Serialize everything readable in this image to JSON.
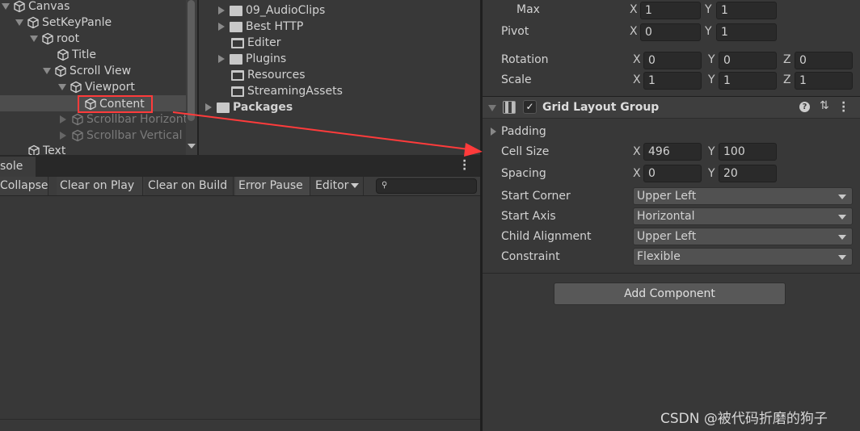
{
  "hierarchy": {
    "items": [
      {
        "label": "Canvas",
        "expanded": true
      },
      {
        "label": "SetKeyPanle",
        "expanded": true
      },
      {
        "label": "root",
        "expanded": true
      },
      {
        "label": "Title"
      },
      {
        "label": "Scroll View",
        "expanded": true
      },
      {
        "label": "Viewport",
        "expanded": true
      },
      {
        "label": "Content",
        "selected": true
      },
      {
        "label": "Scrollbar Horizontal",
        "disabled": true
      },
      {
        "label": "Scrollbar Vertical",
        "disabled": true
      },
      {
        "label": "Text"
      }
    ]
  },
  "project": {
    "folders": [
      {
        "label": "09_AudioClips",
        "has_children": true
      },
      {
        "label": "Best HTTP",
        "has_children": true
      },
      {
        "label": "Editer"
      },
      {
        "label": "Plugins",
        "has_children": true
      },
      {
        "label": "Resources"
      },
      {
        "label": "StreamingAssets"
      },
      {
        "label": "Packages",
        "has_children": true
      }
    ]
  },
  "console": {
    "tab_label": "sole",
    "buttons": [
      "Collapse",
      "Clear on Play",
      "Clear on Build",
      "Error Pause",
      "Editor"
    ],
    "search_placeholder": ""
  },
  "inspector": {
    "max": {
      "label": "Max",
      "x": "1",
      "y": "1"
    },
    "pivot": {
      "label": "Pivot",
      "x": "0",
      "y": "1"
    },
    "rotation": {
      "label": "Rotation",
      "x": "0",
      "y": "0",
      "z": "0"
    },
    "scale": {
      "label": "Scale",
      "x": "1",
      "y": "1",
      "z": "1"
    },
    "axes": {
      "x": "X",
      "y": "Y",
      "z": "Z"
    },
    "component": {
      "title": "Grid Layout Group",
      "enabled": true,
      "padding_label": "Padding",
      "cell_size": {
        "label": "Cell Size",
        "x": "496",
        "y": "100"
      },
      "spacing": {
        "label": "Spacing",
        "x": "0",
        "y": "20"
      },
      "start_corner": {
        "label": "Start Corner",
        "value": "Upper Left"
      },
      "start_axis": {
        "label": "Start Axis",
        "value": "Horizontal"
      },
      "child_alignment": {
        "label": "Child Alignment",
        "value": "Upper Left"
      },
      "constraint": {
        "label": "Constraint",
        "value": "Flexible"
      }
    },
    "add_component": "Add Component"
  },
  "watermark": "CSDN @被代码折磨的狗子",
  "colors": {
    "annotation": "#ff3b3b",
    "selected_row": "#4d4d4d"
  }
}
